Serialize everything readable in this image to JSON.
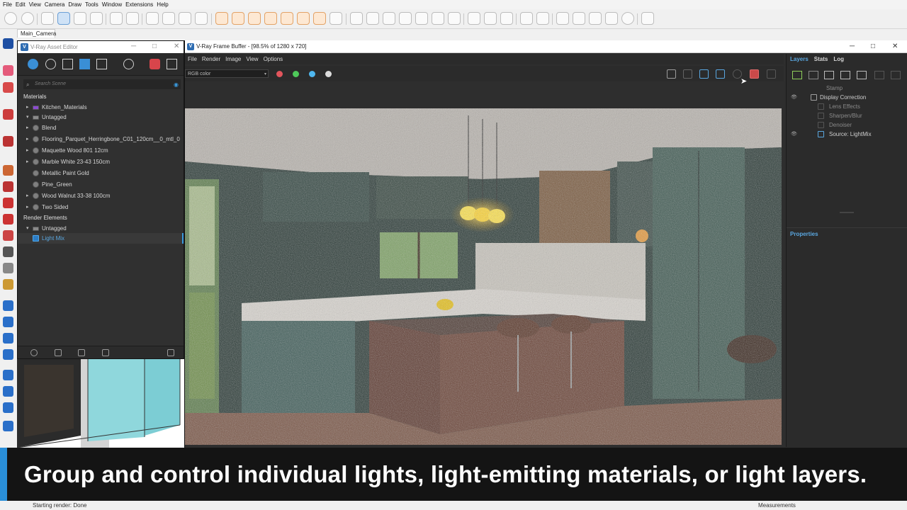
{
  "sketchup": {
    "menus": [
      "File",
      "Edit",
      "View",
      "Camera",
      "Draw",
      "Tools",
      "Window",
      "Extensions",
      "Help"
    ],
    "scene_tab": "Main_Camera",
    "status_left": "Starting render: Done",
    "status_right": "Measurements"
  },
  "asset_editor": {
    "title": "V-Ray Asset Editor",
    "logo": "V",
    "search_placeholder": "Search Scene",
    "materials_header": "Materials",
    "render_elements_header": "Render Elements",
    "materials": [
      {
        "label": "Kitchen_Materials",
        "arrow": "▸",
        "kind": "folder"
      },
      {
        "label": "Untagged",
        "arrow": "▾",
        "kind": "folder"
      },
      {
        "label": "Blend",
        "arrow": "▸"
      },
      {
        "label": "Flooring_Parquet_Herringbone_C01_120cm__0_mtl_0",
        "arrow": "▸"
      },
      {
        "label": "Maquette Wood 801 12cm",
        "arrow": "▸"
      },
      {
        "label": "Marble White 23-43 150cm",
        "arrow": "▸"
      },
      {
        "label": "Metallic Paint Gold",
        "arrow": ""
      },
      {
        "label": "Pine_Green",
        "arrow": ""
      },
      {
        "label": "Wood Walnut 33-38 100cm",
        "arrow": "▸"
      },
      {
        "label": "Two Sided",
        "arrow": "▸"
      }
    ],
    "render_elements": [
      {
        "label": "Untagged",
        "arrow": "▾"
      },
      {
        "label": "Light Mix",
        "arrow": ""
      }
    ]
  },
  "vfb": {
    "title": "V-Ray Frame Buffer - [98.5% of 1280 x 720]",
    "logo": "V",
    "menus": [
      "File",
      "Render",
      "Image",
      "View",
      "Options"
    ],
    "channel": "RGB color",
    "panel_tabs": [
      "Layers",
      "Stats",
      "Log"
    ],
    "layers": [
      {
        "label": "Stamp",
        "dim": true,
        "indent": 1
      },
      {
        "label": "Display Correction",
        "dim": false,
        "indent": 1
      },
      {
        "label": "Lens Effects",
        "dim": true,
        "indent": 2
      },
      {
        "label": "Sharpen/Blur",
        "dim": true,
        "indent": 2
      },
      {
        "label": "Denoiser",
        "dim": true,
        "indent": 2
      },
      {
        "label": "Source: LightMix",
        "dim": false,
        "indent": 2
      }
    ],
    "properties_label": "Properties",
    "colors": {
      "red": "#e2555c",
      "green": "#4fc95a",
      "blue": "#4fb7ef",
      "accent": "#5aa7e0"
    }
  },
  "caption": {
    "text": "Group and control individual lights, light-emitting materials, or light layers."
  }
}
